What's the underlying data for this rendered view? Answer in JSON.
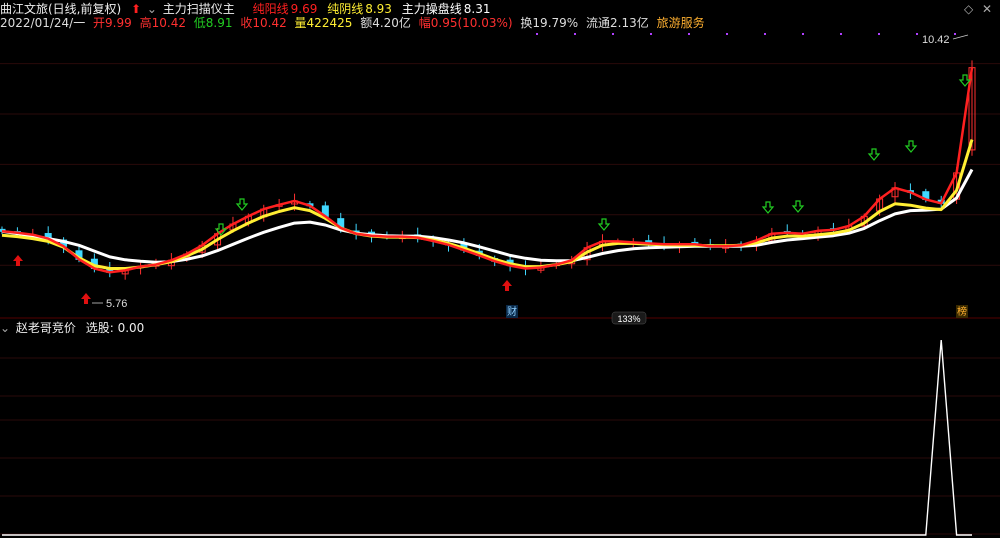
{
  "header": {
    "stock": "曲江文旅(日线,前复权)",
    "indicator": "主力扫描仪主",
    "series": [
      {
        "name": "纯阳线",
        "value": "9.69",
        "color": "#ff2020"
      },
      {
        "name": "纯阴线",
        "value": "8.93",
        "color": "#ffee33"
      },
      {
        "name": "主力操盘线",
        "value": "8.31",
        "color": "#ffffff"
      }
    ]
  },
  "info": {
    "date": "2022/01/24/一",
    "open": "开9.99",
    "high": "高10.42",
    "low": "低8.91",
    "close": "收10.42",
    "volume": "量422425",
    "amount": "额4.20亿",
    "change": "幅0.95(10.03%)",
    "turnover": "换19.79%",
    "float": "流通2.13亿",
    "sector": "旅游服务"
  },
  "annotations": {
    "max": "10.42",
    "min": "5.76",
    "zoom": "133%",
    "badge_cai": "财",
    "badge_bang": "榜"
  },
  "sub": {
    "indicator": "赵老哥竞价",
    "label": "选股: 0.00"
  },
  "colors": {
    "up": "#ff3030",
    "down": "#40d8ff",
    "yellow": "#ffee33",
    "white": "#ffffff",
    "grid": "#2a0a0a",
    "arrowUp": "#e01010",
    "arrowDown": "#22cc22"
  },
  "chart_data": {
    "type": "line",
    "ylim": [
      5.4,
      11.2
    ],
    "series": [
      {
        "name": "纯阳线",
        "color": "#ff2020",
        "values": [
          7.03,
          7.0,
          6.96,
          6.88,
          6.72,
          6.45,
          6.26,
          6.18,
          6.22,
          6.3,
          6.34,
          6.43,
          6.56,
          6.74,
          6.98,
          7.18,
          7.34,
          7.49,
          7.58,
          7.66,
          7.56,
          7.34,
          7.1,
          6.98,
          6.94,
          6.92,
          6.92,
          6.9,
          6.83,
          6.75,
          6.64,
          6.53,
          6.41,
          6.32,
          6.26,
          6.28,
          6.34,
          6.43,
          6.69,
          6.82,
          6.82,
          6.8,
          6.78,
          6.76,
          6.76,
          6.76,
          6.72,
          6.72,
          6.74,
          6.84,
          6.98,
          7.0,
          6.98,
          7.04,
          7.06,
          7.14,
          7.34,
          7.7,
          7.93,
          7.84,
          7.69,
          7.61,
          8.24,
          10.42
        ]
      },
      {
        "name": "纯阴线",
        "color": "#ffee33",
        "values": [
          6.95,
          6.92,
          6.88,
          6.82,
          6.7,
          6.48,
          6.32,
          6.26,
          6.26,
          6.29,
          6.34,
          6.4,
          6.52,
          6.66,
          6.86,
          7.04,
          7.2,
          7.34,
          7.44,
          7.52,
          7.46,
          7.3,
          7.1,
          6.98,
          6.93,
          6.91,
          6.91,
          6.9,
          6.85,
          6.78,
          6.68,
          6.57,
          6.45,
          6.36,
          6.3,
          6.3,
          6.34,
          6.4,
          6.6,
          6.74,
          6.78,
          6.78,
          6.76,
          6.75,
          6.74,
          6.74,
          6.73,
          6.73,
          6.74,
          6.79,
          6.89,
          6.93,
          6.93,
          6.96,
          6.99,
          7.05,
          7.2,
          7.44,
          7.6,
          7.57,
          7.51,
          7.48,
          7.88,
          8.93
        ]
      },
      {
        "name": "主力操盘线",
        "color": "#ffffff",
        "values": [
          7.03,
          6.98,
          6.93,
          6.88,
          6.82,
          6.74,
          6.62,
          6.5,
          6.44,
          6.41,
          6.39,
          6.4,
          6.45,
          6.52,
          6.63,
          6.76,
          6.89,
          7.01,
          7.11,
          7.2,
          7.22,
          7.16,
          7.06,
          6.99,
          6.96,
          6.94,
          6.93,
          6.93,
          6.9,
          6.85,
          6.79,
          6.71,
          6.62,
          6.53,
          6.47,
          6.43,
          6.42,
          6.42,
          6.49,
          6.57,
          6.63,
          6.67,
          6.69,
          6.7,
          6.71,
          6.72,
          6.72,
          6.72,
          6.72,
          6.74,
          6.8,
          6.85,
          6.88,
          6.91,
          6.94,
          6.99,
          7.09,
          7.25,
          7.39,
          7.46,
          7.47,
          7.49,
          7.72,
          8.31
        ]
      }
    ],
    "sub_series": {
      "name": "赵老哥竞价",
      "values": [
        0,
        0,
        0,
        0,
        0,
        0,
        0,
        0,
        0,
        0,
        0,
        0,
        0,
        0,
        0,
        0,
        0,
        0,
        0,
        0,
        0,
        0,
        0,
        0,
        0,
        0,
        0,
        0,
        0,
        0,
        0,
        0,
        0,
        0,
        0,
        0,
        0,
        0,
        0,
        0,
        0,
        0,
        0,
        0,
        0,
        0,
        0,
        0,
        0,
        0,
        0,
        0,
        0,
        0,
        0,
        0,
        0,
        0,
        0,
        0,
        0,
        1,
        0,
        0
      ]
    }
  }
}
